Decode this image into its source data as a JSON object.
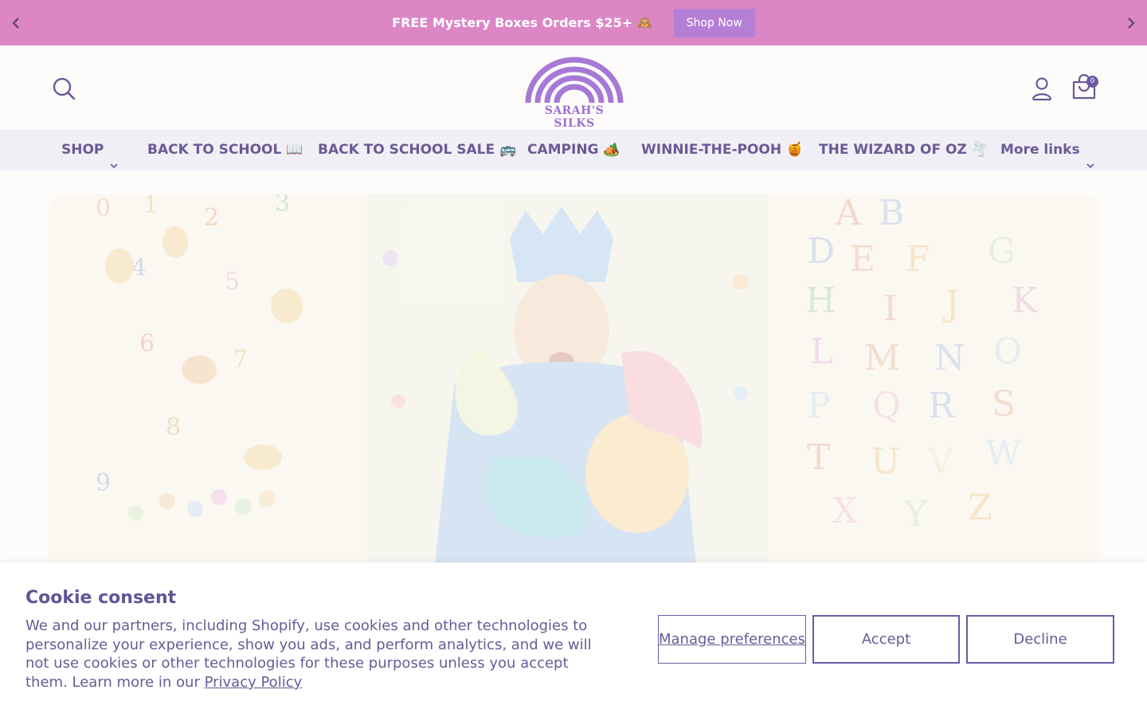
{
  "announcement": {
    "text": "FREE Mystery Boxes Orders $25+ 🙈",
    "cta_label": "Shop Now",
    "prev_icon": "chevron-left-icon",
    "next_icon": "chevron-right-icon"
  },
  "header": {
    "logo_text": "SARAH'S SILKS",
    "cart_count": "0",
    "icons": [
      "search-icon",
      "account-icon",
      "cart-icon"
    ]
  },
  "nav": {
    "items": [
      {
        "label": "SHOP"
      },
      {
        "label": "BACK TO SCHOOL 📖"
      },
      {
        "label": "BACK TO SCHOOL SALE 🚌"
      },
      {
        "label": "CAMPING 🏕️"
      },
      {
        "label": "WINNIE-THE-POOH 🍯"
      },
      {
        "label": "THE WIZARD OF OZ 🌪️"
      },
      {
        "label": "More links"
      }
    ]
  },
  "cookie": {
    "title": "Cookie consent",
    "body": "We and our partners, including Shopify, use cookies and other technologies to personalize your experience, show you ads, and perform analytics, and we will not use cookies or other technologies for these purposes unless you accept them. Learn more in our ",
    "privacy_link": "Privacy Policy",
    "manage_label": "Manage preferences",
    "accept_label": "Accept",
    "decline_label": "Decline"
  },
  "colors": {
    "announce_bg": "#dc86c6",
    "accent": "#6a5aa8",
    "logo": "#9d6fd0"
  }
}
